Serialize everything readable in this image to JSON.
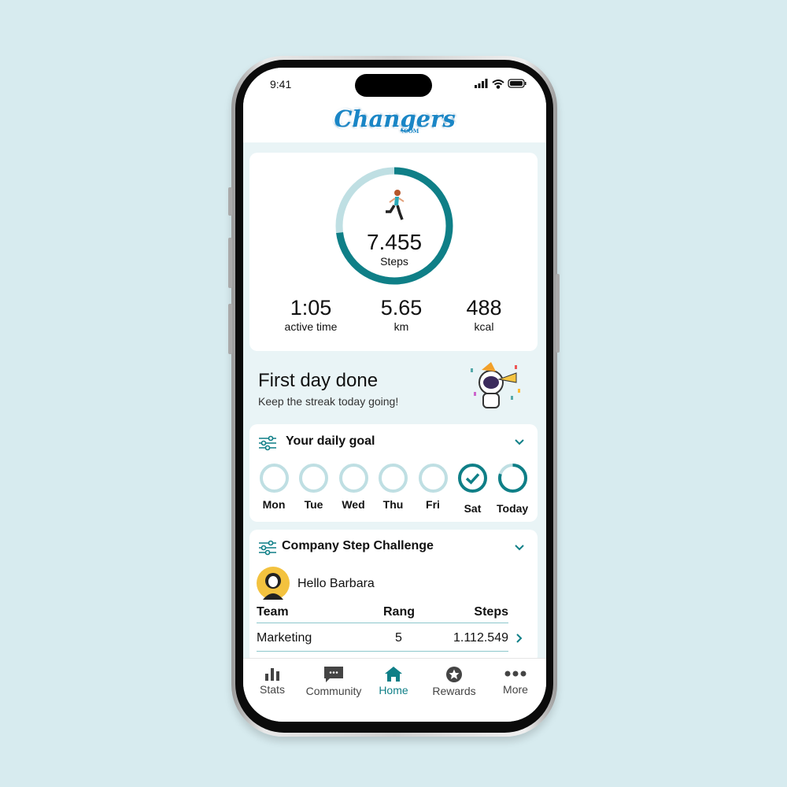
{
  "status_bar": {
    "time": "9:41"
  },
  "brand": {
    "logo": "Changers",
    "logo_suffix": ".COM",
    "accent": "#0f7f87",
    "light": "#bfdfe3"
  },
  "activity": {
    "steps": "7.455",
    "steps_label": "Steps",
    "progress": 0.73,
    "stats": [
      {
        "value": "1:05",
        "label": "active time"
      },
      {
        "value": "5.65",
        "label": "km"
      },
      {
        "value": "488",
        "label": "kcal"
      }
    ]
  },
  "streak": {
    "title": "First day done",
    "subtitle": "Keep the streak today going!"
  },
  "daily_goal": {
    "title": "Your daily goal",
    "days": [
      {
        "label": "Mon",
        "state": "empty"
      },
      {
        "label": "Tue",
        "state": "empty"
      },
      {
        "label": "Wed",
        "state": "empty"
      },
      {
        "label": "Thu",
        "state": "empty"
      },
      {
        "label": "Fri",
        "state": "empty"
      },
      {
        "label": "Sat",
        "state": "done"
      },
      {
        "label": "Today",
        "state": "partial",
        "progress": 0.8
      }
    ]
  },
  "challenge": {
    "title": "Company Step Challenge",
    "greeting": "Hello Barbara",
    "columns": [
      "Team",
      "Rang",
      "Steps"
    ],
    "rows": [
      {
        "team": "Marketing",
        "rank": "5",
        "steps": "1.112.549"
      }
    ]
  },
  "nav": [
    {
      "label": "Stats",
      "icon": "bar-chart-icon"
    },
    {
      "label": "Community",
      "icon": "chat-icon"
    },
    {
      "label": "Home",
      "icon": "home-icon",
      "active": true
    },
    {
      "label": "Rewards",
      "icon": "star-badge-icon"
    },
    {
      "label": "More",
      "icon": "more-icon"
    }
  ]
}
